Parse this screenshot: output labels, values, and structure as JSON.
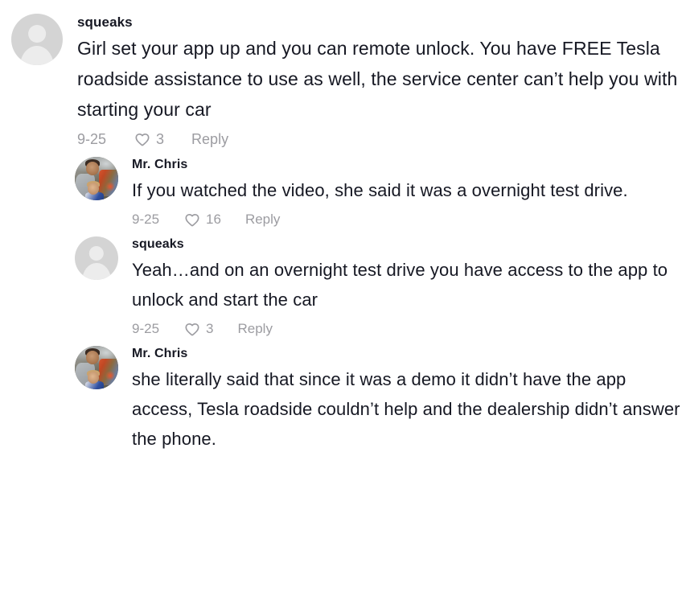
{
  "screen": {
    "type": "comment-thread",
    "background_color": "#ffffff",
    "text_color": "#161823",
    "muted_color": "#9c9ca1"
  },
  "icons": {
    "heart": "heart-outline-icon",
    "avatar_placeholder": "person-placeholder-icon"
  },
  "labels": {
    "reply": "Reply"
  },
  "comments": [
    {
      "level": 0,
      "avatar": "placeholder",
      "username": "squeaks",
      "text": "Girl set your app up and you can remote unlock. You have FREE Tesla roadside assistance to use as well, the service center can’t help you with starting your car",
      "date": "9-25",
      "likes": "3",
      "reply": "Reply"
    },
    {
      "level": 1,
      "avatar": "photo",
      "username": "Mr. Chris",
      "text": "If you watched the video, she said it was a overnight test drive.",
      "date": "9-25",
      "likes": "16",
      "reply": "Reply"
    },
    {
      "level": 1,
      "avatar": "placeholder",
      "username": "squeaks",
      "text": "Yeah…and on an overnight test drive you have access to the app to unlock and start the car",
      "date": "9-25",
      "likes": "3",
      "reply": "Reply"
    },
    {
      "level": 1,
      "avatar": "photo",
      "username": "Mr. Chris",
      "text": "she literally said that since it was a demo it didn’t have the app access, Tesla roadside couldn’t help and the dealership didn’t answer the phone.",
      "date": "9-25",
      "likes": "",
      "reply": "",
      "meta_hidden": true
    }
  ]
}
